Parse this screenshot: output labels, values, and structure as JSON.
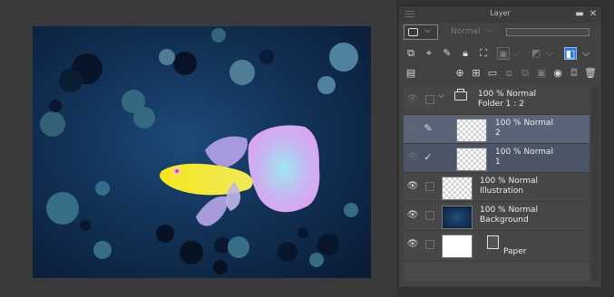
{
  "panel": {
    "title": "Layer",
    "close_glyph": "✕",
    "menu_glyph": "☰",
    "blend_mode": "Normal"
  },
  "toolbar": {
    "row1_icons": [
      "copy-layer-icon",
      "lightbulb-icon",
      "move-pin-icon",
      "lock-icon",
      "alpha-lock-icon",
      "ref-layer-icon",
      "mask-icon",
      "clip-icon",
      "color-icon"
    ],
    "row2_icons": [
      "layer-property-icon",
      "new-raster-icon",
      "new-vector-icon",
      "new-folder-icon",
      "transfer-down-icon",
      "merge-icon",
      "mask-add-icon",
      "mask-apply-icon",
      "delete-layer-icon"
    ]
  },
  "layers": [
    {
      "opacity": "100 %",
      "blend": "Normal",
      "name": "Folder 1 : 2",
      "type": "folder"
    },
    {
      "opacity": "100 %",
      "blend": "Normal",
      "name": "2",
      "type": "raster",
      "selected": true
    },
    {
      "opacity": "100 %",
      "blend": "Normal",
      "name": "1",
      "type": "raster"
    },
    {
      "opacity": "100 %",
      "blend": "Normal",
      "name": "Illustration",
      "type": "raster"
    },
    {
      "opacity": "100 %",
      "blend": "Normal",
      "name": "Background",
      "type": "raster"
    },
    {
      "opacity": "",
      "blend": "",
      "name": "Paper",
      "type": "paper"
    }
  ],
  "colors": {
    "accent": "#2d7ad6",
    "selected_row": "#5a6478",
    "artwork_bg": "#123257"
  }
}
